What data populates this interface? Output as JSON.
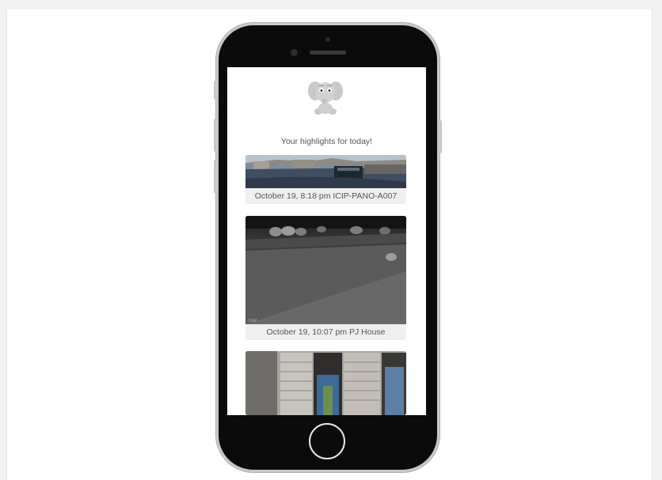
{
  "headline": "Your highlights for today!",
  "highlights": [
    {
      "timestamp": "October 19, 8:18 pm",
      "camera": "ICIP-PANO-A007",
      "caption": "October 19, 8:18 pm ICIP-PANO-A007"
    },
    {
      "timestamp": "October 19, 10:07 pm",
      "camera": "PJ House",
      "caption": "October 19, 10:07 pm PJ House"
    },
    {
      "timestamp": "",
      "camera": "",
      "caption": ""
    }
  ],
  "colors": {
    "phone_body": "#0b0b0b",
    "phone_rim": "#c9c9cd",
    "caption_bg": "#efefef",
    "caption_text": "#555555",
    "logo_gray": "#c4c4c4"
  },
  "icons": [
    "elephant-logo-icon",
    "home-button"
  ]
}
